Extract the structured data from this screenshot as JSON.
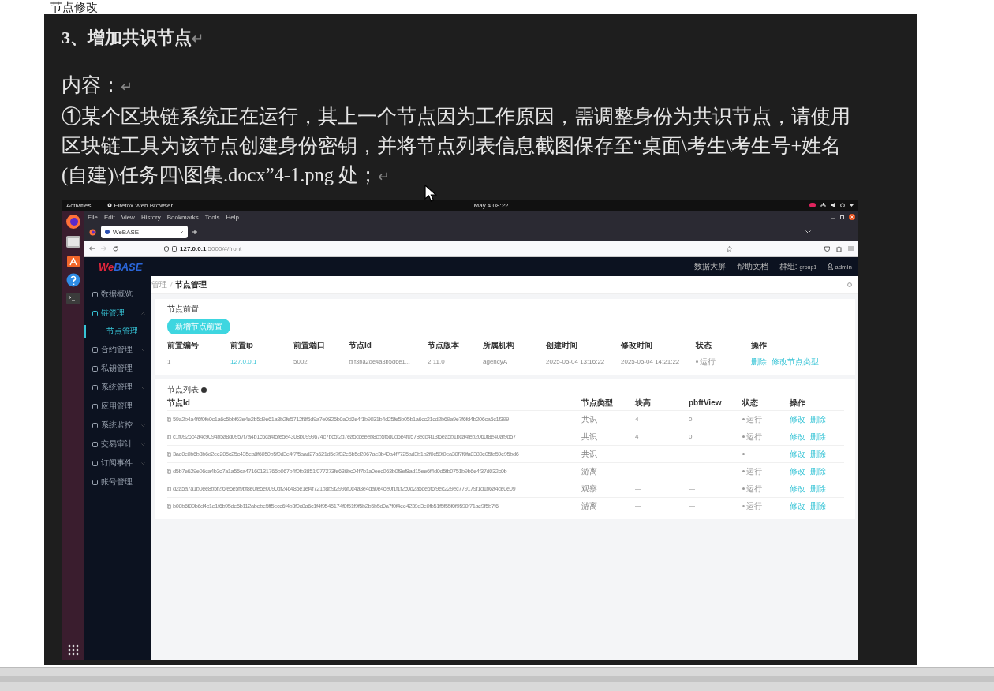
{
  "above_text": "节点修改",
  "document": {
    "paragraphs": [
      {
        "kind": "heading",
        "text": "3、增加共识节点",
        "return_mark": "↵"
      },
      {
        "kind": "spacer"
      },
      {
        "kind": "body",
        "text": "内容：",
        "return_mark": "↵"
      },
      {
        "kind": "body",
        "text": "①某个区块链系统正在运行，其上一个节点因为工作原因，需调整身份为共识节点，请使用区块链工具为该节点创建身份密钥，并将节点列表信息截图保存至“桌面\\考生\\考生号+姓名(自建)\\任务四\\图集.docx”4-1.png 处；",
        "return_mark": "↵"
      }
    ]
  },
  "screenshot": {
    "desktop": {
      "activities": "Activities",
      "app_menu": "Firefox Web Browser",
      "clock": "May 4 08:22"
    },
    "browser": {
      "menu": [
        "File",
        "Edit",
        "View",
        "History",
        "Bookmarks",
        "Tools",
        "Help"
      ],
      "tabs": [
        {
          "title": "WeBASE",
          "selected": true
        }
      ],
      "url_host": "127.0.0.1",
      "url_path": ":5000/#/front"
    },
    "app": {
      "logo_a": "We",
      "logo_b": "BASE",
      "nav": [
        "数据大屏",
        "帮助文档"
      ],
      "group_label": "群组:",
      "group": "group1",
      "user": "admin",
      "sidebar": [
        {
          "label": "数据概览",
          "expandable": false,
          "expanded": false,
          "selected": false
        },
        {
          "label": "链管理",
          "expandable": true,
          "expanded": true,
          "selected": false,
          "children": [
            {
              "label": "节点管理",
              "selected": true
            }
          ]
        },
        {
          "label": "合约管理",
          "expandable": true,
          "expanded": false,
          "selected": false
        },
        {
          "label": "私钥管理",
          "expandable": false,
          "expanded": false,
          "selected": false
        },
        {
          "label": "系统管理",
          "expandable": true,
          "expanded": false,
          "selected": false
        },
        {
          "label": "应用管理",
          "expandable": false,
          "expanded": false,
          "selected": false
        },
        {
          "label": "系统监控",
          "expandable": true,
          "expanded": false,
          "selected": false
        },
        {
          "label": "交易审计",
          "expandable": true,
          "expanded": false,
          "selected": false
        },
        {
          "label": "订阅事件",
          "expandable": true,
          "expanded": false,
          "selected": false
        },
        {
          "label": "账号管理",
          "expandable": false,
          "expanded": false,
          "selected": false
        }
      ],
      "breadcrumb": [
        "管理",
        "节点管理"
      ],
      "front_section": {
        "title": "节点前置",
        "add_button": "新增节点前置",
        "columns": [
          "前置编号",
          "前置ip",
          "前置端口",
          "节点Id",
          "节点版本",
          "所属机构",
          "创建时间",
          "修改时间",
          "状态",
          "操作"
        ],
        "rows": [
          {
            "cells": [
              {
                "kind": "text",
                "text": "1"
              },
              {
                "kind": "link",
                "text": "127.0.0.1"
              },
              {
                "kind": "text",
                "text": "5002"
              },
              {
                "kind": "node",
                "text": "f3ba2de4a8b5d6e1..."
              },
              {
                "kind": "text",
                "text": "2.11.0"
              },
              {
                "kind": "text",
                "text": "agencyA"
              },
              {
                "kind": "text",
                "text": "2025-05-04 13:16:22"
              },
              {
                "kind": "text",
                "text": "2025-05-04 14:21:22"
              },
              {
                "kind": "status",
                "text": "运行"
              }
            ],
            "actions": [
              "删除",
              "修改节点类型"
            ]
          }
        ]
      },
      "node_section": {
        "title": "节点列表",
        "columns": [
          "节点Id",
          "节点类型",
          "块高",
          "pbftView",
          "状态",
          "操作"
        ],
        "rows": [
          {
            "cells": [
              {
                "kind": "node",
                "text": "59a2b4a4f6f0fe0c1a6c5bbf63e4e2b5d9e61a8b2fe5712f8f5d9a7e0825b0a0d2e4f1b9031b4d25fe5b05b1a6cc21cd2b69a9e7f6fd4b206ca5c1f399"
              },
              {
                "kind": "text",
                "text": "共识"
              },
              {
                "kind": "text",
                "text": "4"
              },
              {
                "kind": "text",
                "text": "0"
              },
              {
                "kind": "status",
                "text": "运行"
              }
            ],
            "actions": [
              "修改",
              "删除"
            ]
          },
          {
            "cells": [
              {
                "kind": "node",
                "text": "c1f0926c4a4c9094b5a8d0957f7a4b1c6ca4f5fe5e4308b0999674c7bc5f2d7ea5cceeeb8cb5f5d0d5e4f0578ecc4f13f6ea5b1bca4feb2060f8e40af9d57"
              },
              {
                "kind": "text",
                "text": "共识"
              },
              {
                "kind": "text",
                "text": "4"
              },
              {
                "kind": "text",
                "text": "0"
              },
              {
                "kind": "status",
                "text": "运行"
              }
            ],
            "actions": [
              "修改",
              "删除"
            ]
          },
          {
            "cells": [
              {
                "kind": "node",
                "text": "3ae0e0b6b3b6d2ee205c25c435ea8f6050b5f0d3e4f7f5aad27a621d5c7f32e5b5d2067ae3b40a4f7725ad3b1b2f0c59f0ea30f7f0fa0380e05fa59e95bd6"
              },
              {
                "kind": "text",
                "text": "共识"
              },
              {
                "kind": "empty"
              },
              {
                "kind": "empty"
              },
              {
                "kind": "status"
              }
            ],
            "actions": [
              "修改",
              "删除"
            ]
          },
          {
            "cells": [
              {
                "kind": "node",
                "text": "d5b7e629e06ca4b3c7a1a55ca47160131765b067b4f0fb3851f077273fe636bc04f7b1a0eec063b0f8ef8ad15ee6f4d0d5fb0751b9b6e4f37d032c0b"
              },
              {
                "kind": "text",
                "text": "游离"
              },
              {
                "kind": "text",
                "text": "—"
              },
              {
                "kind": "text",
                "text": "—"
              },
              {
                "kind": "status",
                "text": "运行"
              }
            ],
            "actions": [
              "修改",
              "删除"
            ]
          },
          {
            "cells": [
              {
                "kind": "node",
                "text": "d2a5a7a1b0ee8b5f2f6fe5e5f9bf8e0fe5e0090df246485e1ef4f721b8b9f2996f0c4a3e4da0e4ce0f1f1f2c0d2a5ce5f6f9ec229ec779179f1d1b6a4ce0e09"
              },
              {
                "kind": "text",
                "text": "观察"
              },
              {
                "kind": "text",
                "text": "—"
              },
              {
                "kind": "text",
                "text": "—"
              },
              {
                "kind": "status",
                "text": "运行"
              }
            ],
            "actions": [
              "修改",
              "删除"
            ]
          },
          {
            "cells": [
              {
                "kind": "node",
                "text": "b00b6f09b6d4c1e1f6b95de5b112abebe5ff5ecc6f4b3f0c8a6c1f4f9545174f0f51f9f5b2b5b5d0a7f0f4ee4239d3e0fb51f5f55f0f9590f71ae9f5b7f6"
              },
              {
                "kind": "text",
                "text": "游离"
              },
              {
                "kind": "text",
                "text": "—"
              },
              {
                "kind": "text",
                "text": "—"
              },
              {
                "kind": "status",
                "text": "运行"
              }
            ],
            "actions": [
              "修改",
              "删除"
            ]
          }
        ]
      }
    }
  }
}
